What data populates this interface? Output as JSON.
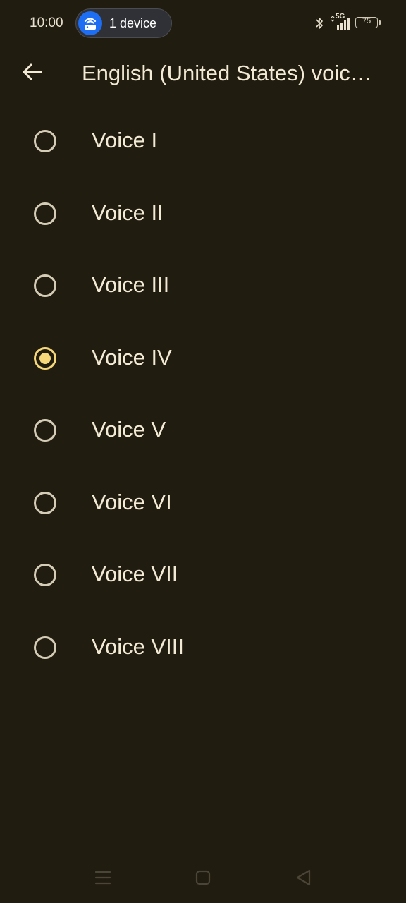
{
  "status_bar": {
    "time": "10:00",
    "hotspot": {
      "label": "1 device",
      "icon": "wifi-router-icon",
      "color": "#1e6ef4"
    },
    "icons": [
      "bluetooth-icon",
      "5g-signal-icon",
      "battery-icon"
    ],
    "network_type": "5G",
    "battery_level": "75"
  },
  "app_bar": {
    "back_icon": "arrow-back-icon",
    "title": "English (United States) voic…"
  },
  "voices": [
    {
      "label": "Voice I",
      "selected": false
    },
    {
      "label": "Voice II",
      "selected": false
    },
    {
      "label": "Voice III",
      "selected": false
    },
    {
      "label": "Voice IV",
      "selected": true
    },
    {
      "label": "Voice V",
      "selected": false
    },
    {
      "label": "Voice VI",
      "selected": false
    },
    {
      "label": "Voice VII",
      "selected": false
    },
    {
      "label": "Voice VIII",
      "selected": false
    }
  ],
  "nav_bar": {
    "icons": [
      "menu-icon",
      "home-square-icon",
      "back-triangle-icon"
    ]
  },
  "colors": {
    "background": "#211c10",
    "text": "#f3ead5",
    "accent": "#f6d77a",
    "radio_border": "#d4ccb6"
  }
}
